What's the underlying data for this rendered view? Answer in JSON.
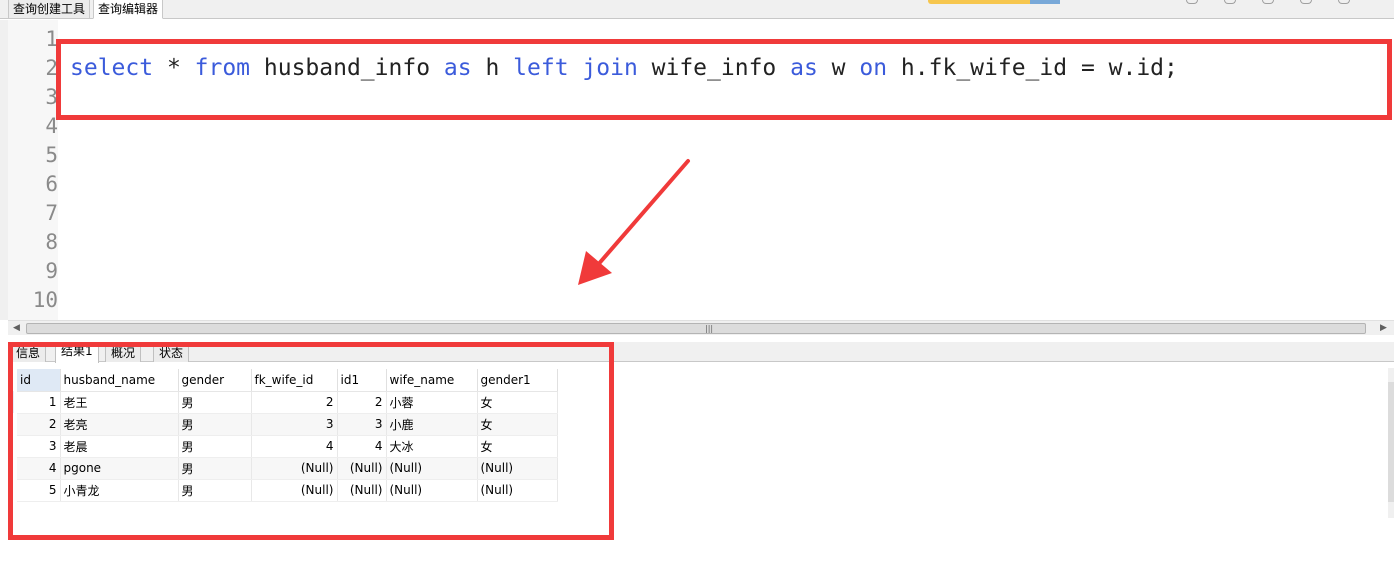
{
  "top_tabs": [
    {
      "label": "查询创建工具",
      "active": false
    },
    {
      "label": "查询编辑器",
      "active": true
    }
  ],
  "editor": {
    "line_numbers": [
      "1",
      "2",
      "3",
      "4",
      "5",
      "6",
      "7",
      "8",
      "9",
      "10"
    ],
    "sql": {
      "select": "select",
      "star": " * ",
      "from": "from",
      "table1": " husband_info ",
      "as1": "as",
      "alias1": " h ",
      "left": "left",
      "sp": " ",
      "join": "join",
      "table2": " wife_info ",
      "as2": "as",
      "alias2": " w ",
      "on": "on",
      "cond": " h.fk_wife_id = w.id;"
    },
    "keyword_color": "#3b5bdb"
  },
  "result_tabs": [
    {
      "label": "信息",
      "active": false
    },
    {
      "label": "结果1",
      "active": true
    },
    {
      "label": "概况",
      "active": false
    },
    {
      "label": "状态",
      "active": false
    }
  ],
  "grid": {
    "columns": [
      "id",
      "husband_name",
      "gender",
      "fk_wife_id",
      "id1",
      "wife_name",
      "gender1"
    ],
    "rows": [
      [
        "1",
        "老王",
        "男",
        "2",
        "2",
        "小蓉",
        "女"
      ],
      [
        "2",
        "老亮",
        "男",
        "3",
        "3",
        "小鹿",
        "女"
      ],
      [
        "3",
        "老晨",
        "男",
        "4",
        "4",
        "大冰",
        "女"
      ],
      [
        "4",
        "pgone",
        "男",
        "(Null)",
        "(Null)",
        "(Null)",
        "(Null)"
      ],
      [
        "5",
        "小青龙",
        "男",
        "(Null)",
        "(Null)",
        "(Null)",
        "(Null)"
      ]
    ]
  },
  "annotation_color": "#f03a3a"
}
